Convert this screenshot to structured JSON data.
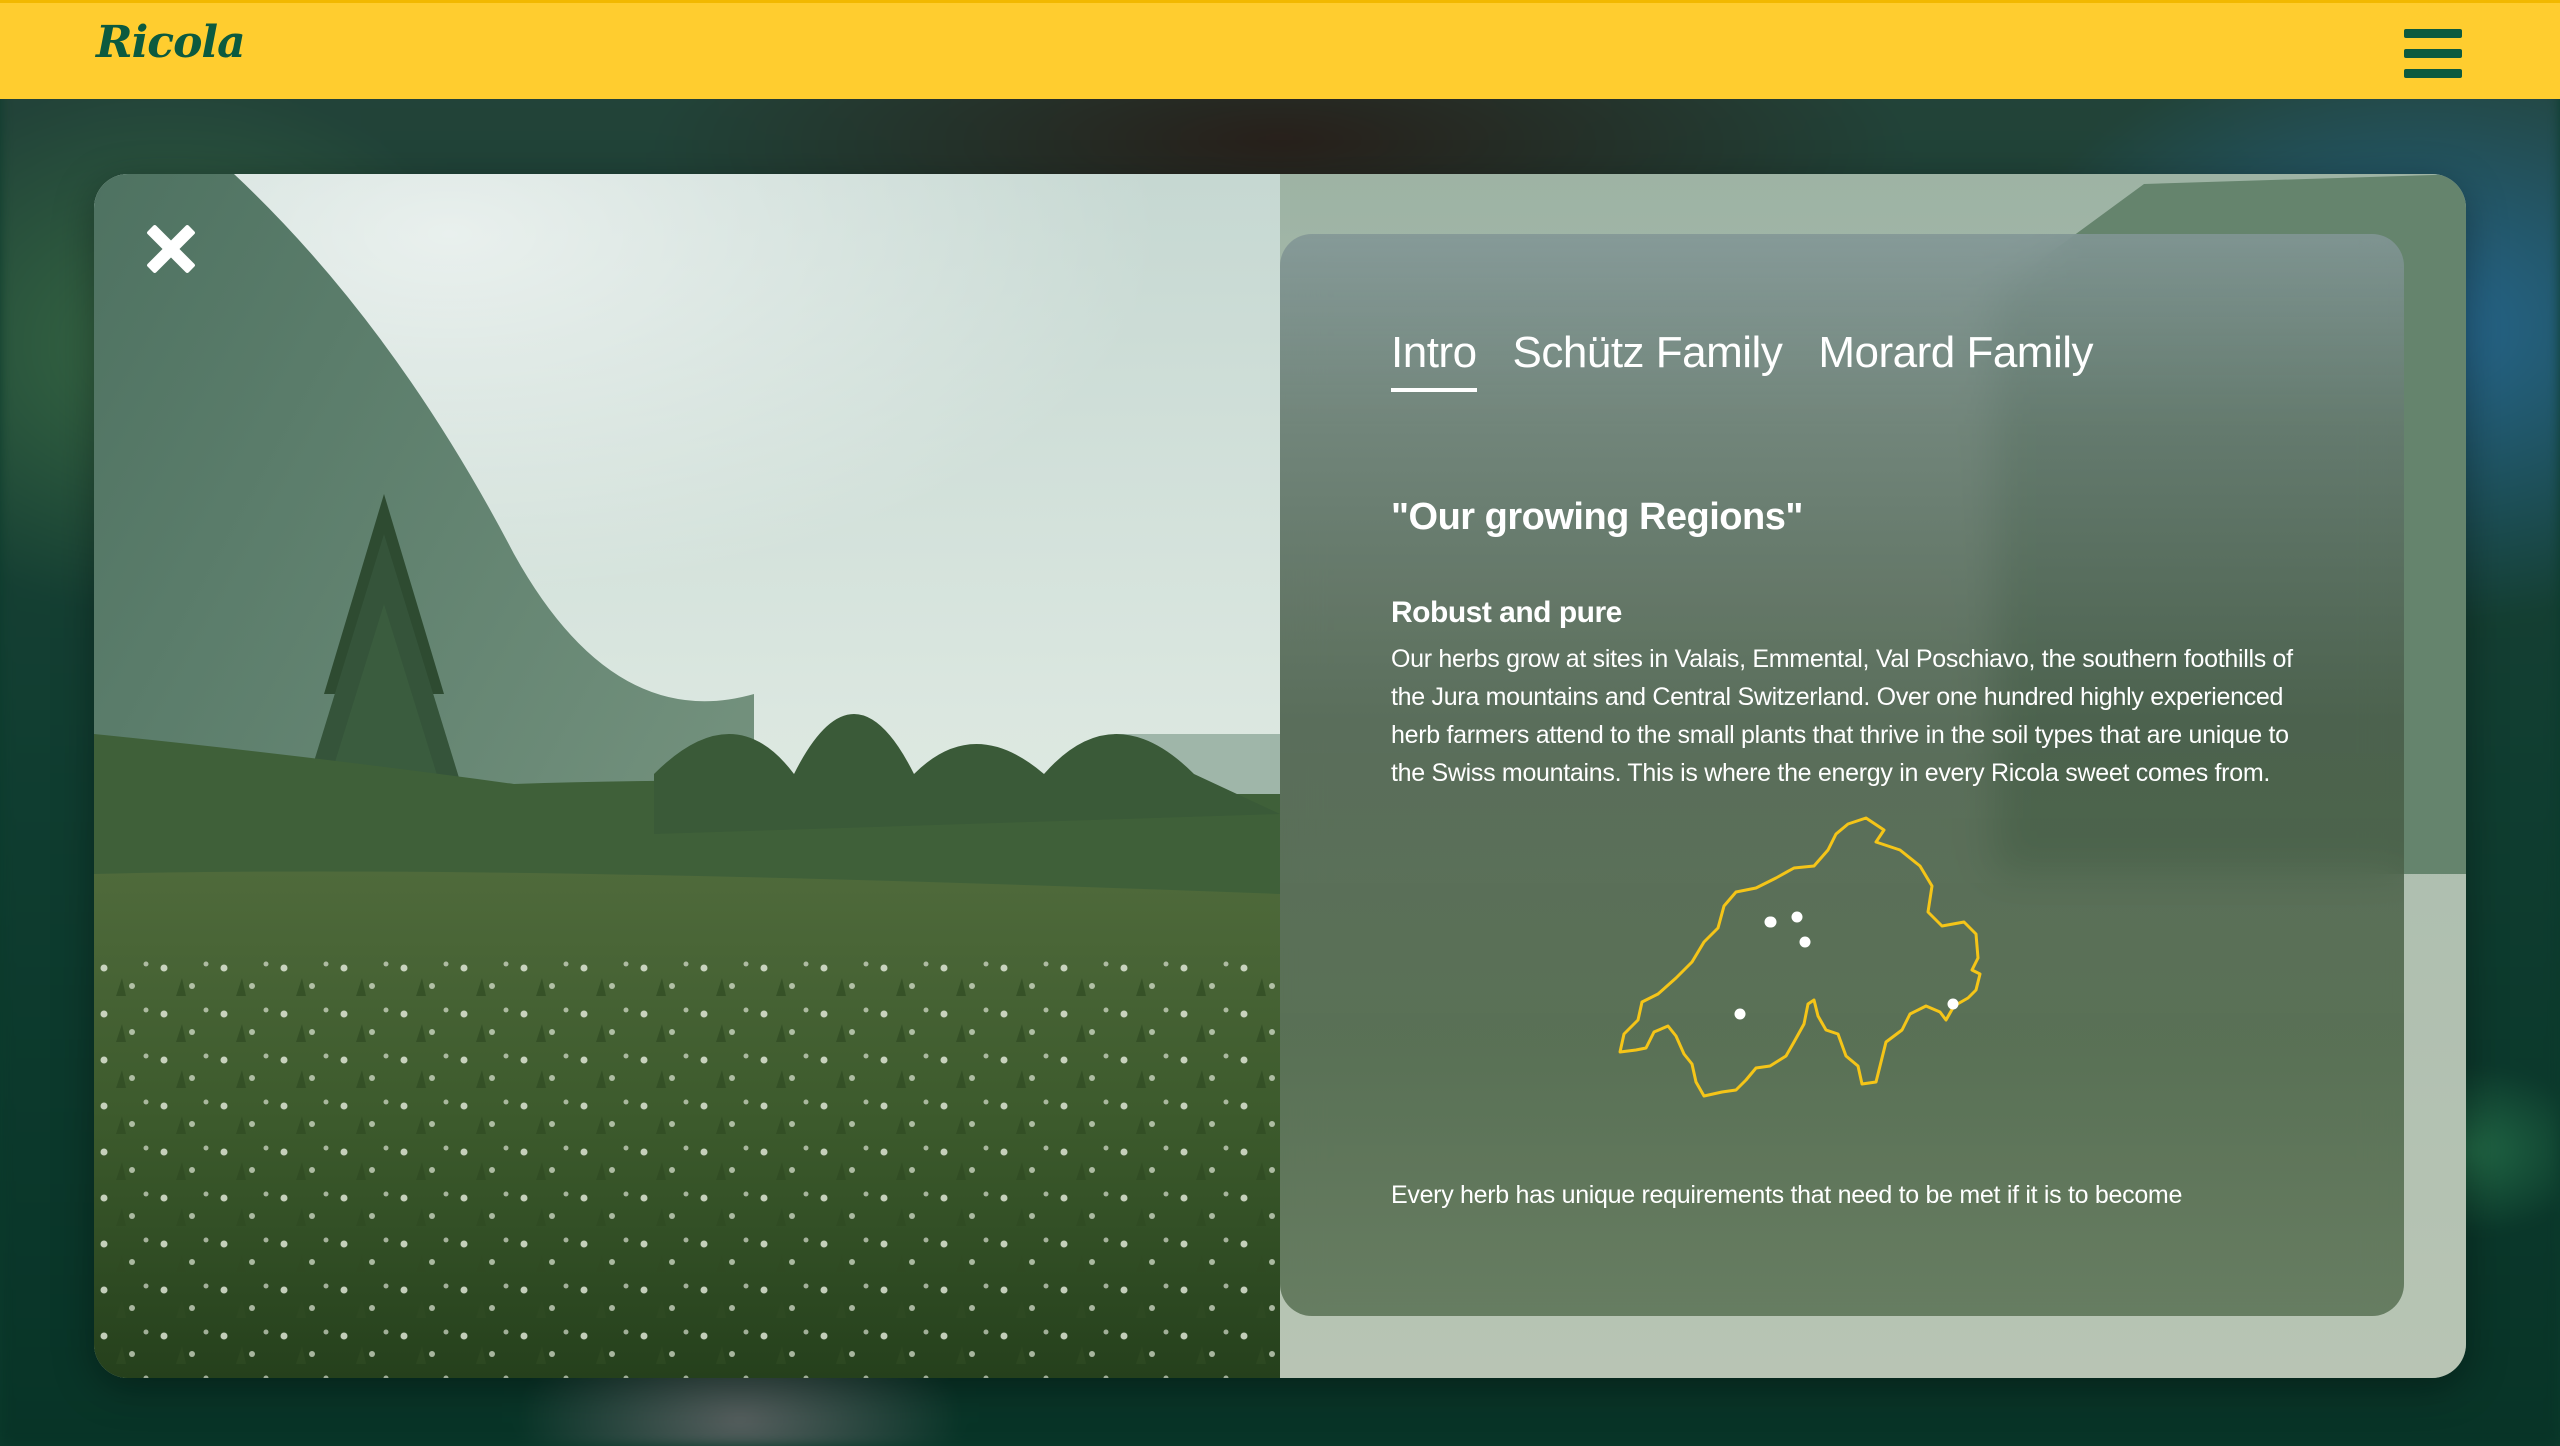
{
  "header": {
    "logo_text": "Ricola",
    "menu_icon": "hamburger-menu-icon",
    "background_color": "#ffcd2f",
    "brand_color": "#0c5a3f"
  },
  "modal": {
    "close_icon": "close-icon",
    "scene": "alpine meadow with fir trees and mountains",
    "panel": {
      "tabs": [
        {
          "label": "Intro",
          "active": true
        },
        {
          "label": "Schütz Family",
          "active": false
        },
        {
          "label": "Morard Family",
          "active": false
        }
      ],
      "headline": "\"Our growing Regions\"",
      "subheading": "Robust and pure",
      "body": "Our herbs grow at sites in Valais, Emmental, Val Poschiavo, the southern foothills of the Jura mountains and Central Switzerland. Over one hundred highly experienced herb farmers attend to the small plants that thrive in the soil types that are unique to the Swiss mountains. This is where the energy in every Ricola sweet comes from.",
      "map_icon": "switzerland-map-icon",
      "map_outline_color": "#f5c518",
      "footer_text": "Every herb has unique requirements that need to be met if it is to become"
    }
  }
}
